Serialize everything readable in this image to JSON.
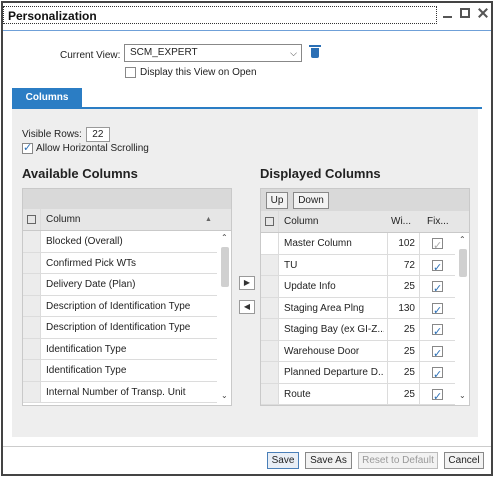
{
  "dialog": {
    "title": "Personalization"
  },
  "current_view": {
    "label": "Current View:",
    "value": "SCM_EXPERT",
    "display_on_open_label": "Display this View on Open"
  },
  "tabs": [
    {
      "label": "Columns"
    }
  ],
  "settings": {
    "visible_rows_label": "Visible Rows:",
    "visible_rows_value": "22",
    "horizontal_scroll_label": "Allow Horizontal Scrolling"
  },
  "available": {
    "title": "Available Columns",
    "column_header": "Column",
    "rows": [
      "Blocked (Overall)",
      "Confirmed Pick WTs",
      "Delivery Date (Plan)",
      "Description of Identification Type",
      "Description of Identification Type",
      "Identification Type",
      "Identification Type",
      "Internal Number of Transp. Unit"
    ]
  },
  "displayed": {
    "title": "Displayed Columns",
    "up_label": "Up",
    "down_label": "Down",
    "headers": {
      "column": "Column",
      "width": "Wi...",
      "fixed": "Fix..."
    },
    "rows": [
      {
        "column": "Master Column",
        "width": "102"
      },
      {
        "column": "TU",
        "width": "72"
      },
      {
        "column": "Update Info",
        "width": "25"
      },
      {
        "column": "Staging Area Plng",
        "width": "130"
      },
      {
        "column": "Staging Bay (ex GI-Z...",
        "width": "25"
      },
      {
        "column": "Warehouse Door",
        "width": "25"
      },
      {
        "column": "Planned Departure D...",
        "width": "25"
      },
      {
        "column": "Route",
        "width": "25"
      }
    ]
  },
  "footer": {
    "save": "Save",
    "save_as": "Save As",
    "reset": "Reset to Default",
    "cancel": "Cancel"
  },
  "colors": {
    "accent": "#2b7dc4",
    "panel": "#eeeeee"
  }
}
